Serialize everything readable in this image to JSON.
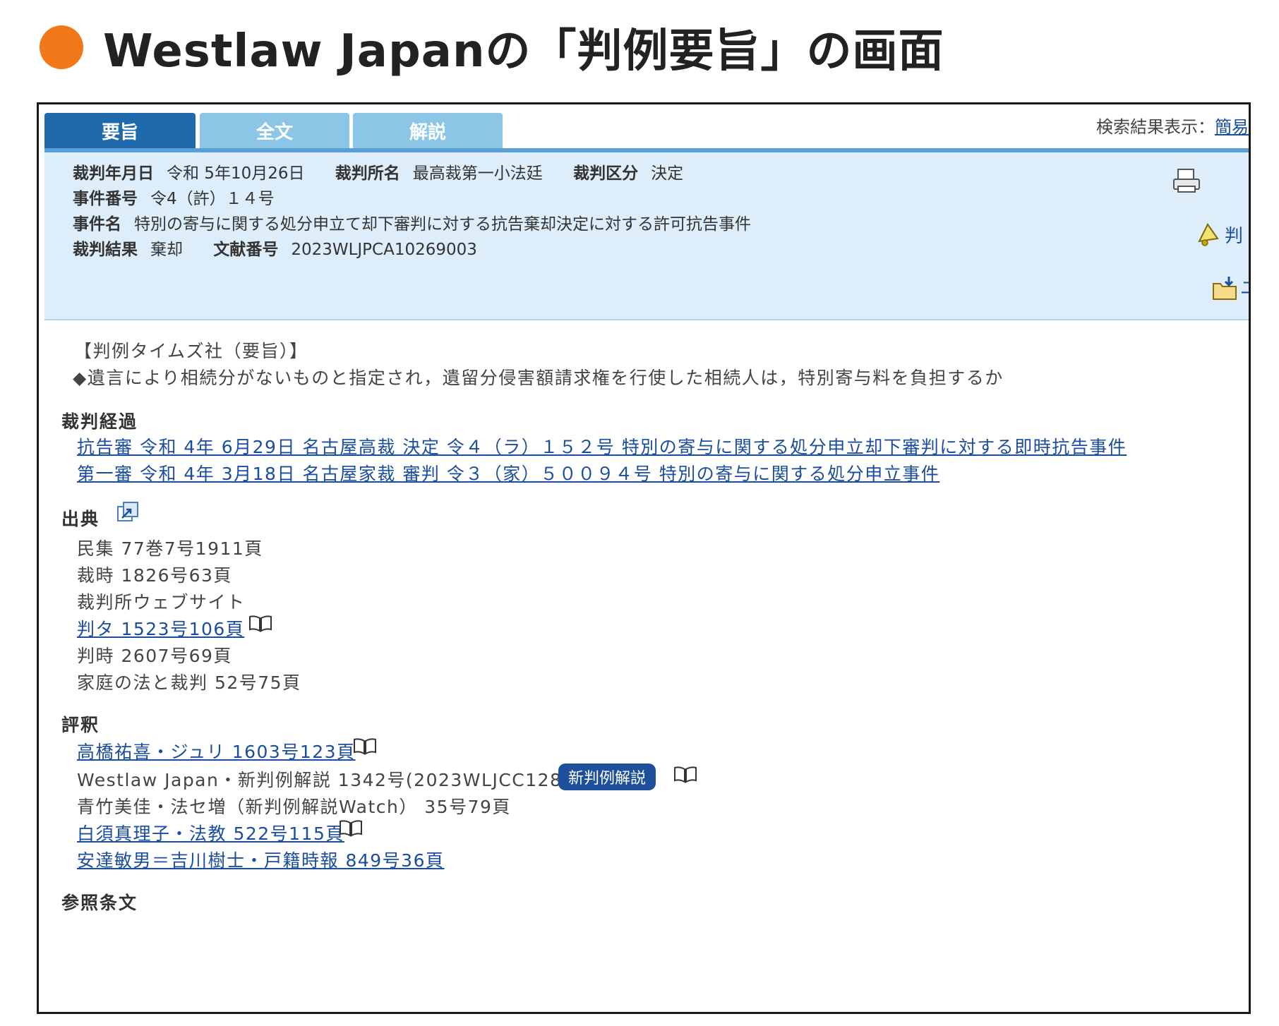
{
  "heading": {
    "text": "Westlaw Japanの「判例要旨」の画面"
  },
  "tabs": [
    {
      "label": "要旨"
    },
    {
      "label": "全文"
    },
    {
      "label": "解説"
    }
  ],
  "search_display": {
    "label": "検索結果表示：",
    "link": "簡易"
  },
  "info": {
    "date_label": "裁判年月日",
    "date_value": "令和 5年10月26日",
    "court_label": "裁判所名",
    "court_value": "最高裁第一小法廷",
    "type_label": "裁判区分",
    "type_value": "決定",
    "case_no_label": "事件番号",
    "case_no_value": "令4（許）１４号",
    "case_name_label": "事件名",
    "case_name_value": "特別の寄与に関する処分申立て却下審判に対する抗告棄却決定に対する許可抗告事件",
    "result_label": "裁判結果",
    "result_value": "棄却",
    "doc_no_label": "文献番号",
    "doc_no_value": "2023WLJPCA10269003",
    "side_link_1": "判",
    "side_link_2": "ユ"
  },
  "summary": {
    "source": "【判例タイムズ社（要旨）】",
    "point": "◆遺言により相続分がないものと指定され，遺留分侵害額請求権を行使した相続人は，特別寄与料を負担するか"
  },
  "history": {
    "heading": "裁判経過",
    "items": [
      "抗告審 令和 4年 6月29日 名古屋高裁 決定 令４（ラ）１５２号 特別の寄与に関する処分申立却下審判に対する即時抗告事件",
      "第一審 令和 4年 3月18日 名古屋家裁 審判 令３（家）５００９４号 特別の寄与に関する処分申立事件"
    ]
  },
  "sources": {
    "heading": "出典",
    "items": [
      "民集 77巻7号1911頁",
      "裁時 1826号63頁",
      "裁判所ウェブサイト",
      "判タ 1523号106頁",
      "判時 2607号69頁",
      "家庭の法と裁判 52号75頁"
    ]
  },
  "commentary": {
    "heading": "評釈",
    "items": [
      "高橋祐喜・ジュリ 1603号123頁",
      "Westlaw Japan・新判例解説 1342号(2023WLJCC128)",
      "青竹美佳・法セ増（新判例解説Watch） 35号79頁",
      "白須真理子・法教 522号115頁",
      "安達敏男＝吉川樹士・戸籍時報 849号36頁"
    ],
    "badge": "新判例解説"
  },
  "references": {
    "heading": "参照条文"
  },
  "colors": {
    "accent_dot": "#f07818",
    "tab_active": "#1e6aad",
    "tab_inactive": "#8cc6e6",
    "info_bg": "#ddeefa",
    "link": "#1a4d9e"
  },
  "icons": [
    "print-icon",
    "bell-icon",
    "folder-download-icon",
    "external-link-icon",
    "book-icon"
  ]
}
